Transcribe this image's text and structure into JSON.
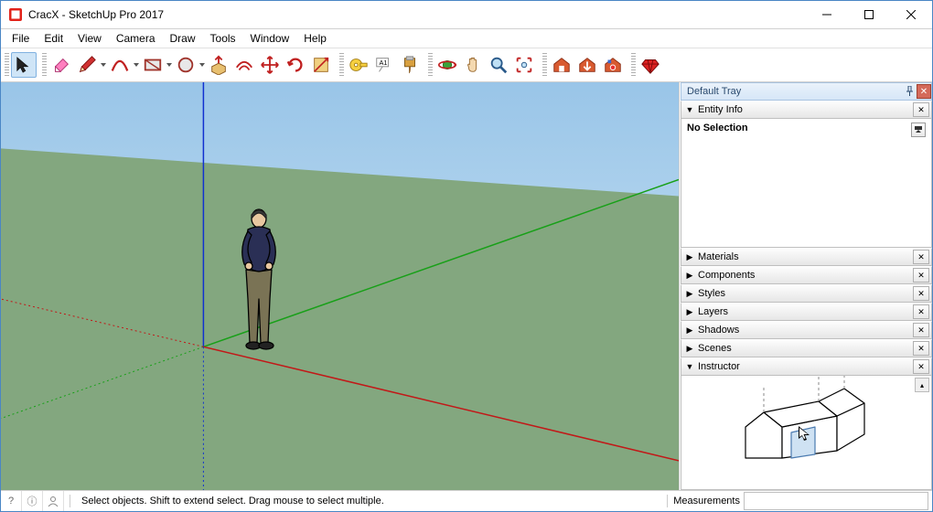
{
  "title": "CracX - SketchUp Pro 2017",
  "menus": [
    "File",
    "Edit",
    "View",
    "Camera",
    "Draw",
    "Tools",
    "Window",
    "Help"
  ],
  "toolbar": [
    {
      "name": "select-tool-icon",
      "kind": "select",
      "selected": true
    },
    {
      "sep": true
    },
    {
      "name": "eraser-tool-icon",
      "kind": "eraser"
    },
    {
      "name": "pencil-tool-icon",
      "kind": "pencil",
      "dd": true
    },
    {
      "name": "arc-tool-icon",
      "kind": "arc",
      "dd": true
    },
    {
      "name": "rectangle-tool-icon",
      "kind": "rect",
      "dd": true
    },
    {
      "name": "circle-tool-icon",
      "kind": "circle",
      "dd": true
    },
    {
      "name": "pushpull-tool-icon",
      "kind": "pushpull"
    },
    {
      "name": "offset-tool-icon",
      "kind": "offset"
    },
    {
      "name": "move-tool-icon",
      "kind": "move"
    },
    {
      "name": "rotate-tool-icon",
      "kind": "rotate"
    },
    {
      "name": "scale-tool-icon",
      "kind": "scale"
    },
    {
      "sep": true
    },
    {
      "name": "tape-tool-icon",
      "kind": "tape"
    },
    {
      "name": "text-tool-icon",
      "kind": "text"
    },
    {
      "name": "paint-tool-icon",
      "kind": "paint"
    },
    {
      "sep": true
    },
    {
      "name": "orbit-tool-icon",
      "kind": "orbit"
    },
    {
      "name": "pan-tool-icon",
      "kind": "pan"
    },
    {
      "name": "zoom-tool-icon",
      "kind": "zoom"
    },
    {
      "name": "zoom-extents-tool-icon",
      "kind": "extents"
    },
    {
      "sep": true
    },
    {
      "name": "warehouse-icon",
      "kind": "wh1"
    },
    {
      "name": "warehouse-get-icon",
      "kind": "wh2"
    },
    {
      "name": "extension-warehouse-icon",
      "kind": "wh3"
    },
    {
      "sep": true
    },
    {
      "name": "ruby-icon",
      "kind": "ruby"
    }
  ],
  "tray": {
    "title": "Default Tray",
    "panels": [
      {
        "label": "Entity Info",
        "open": true,
        "body": "nosel"
      },
      {
        "label": "Materials",
        "open": false
      },
      {
        "label": "Components",
        "open": false
      },
      {
        "label": "Styles",
        "open": false
      },
      {
        "label": "Layers",
        "open": false
      },
      {
        "label": "Shadows",
        "open": false
      },
      {
        "label": "Scenes",
        "open": false
      },
      {
        "label": "Instructor",
        "open": true,
        "body": "instructor"
      }
    ],
    "nosel_label": "No Selection"
  },
  "status": {
    "hint": "Select objects. Shift to extend select. Drag mouse to select multiple.",
    "measure_label": "Measurements"
  }
}
